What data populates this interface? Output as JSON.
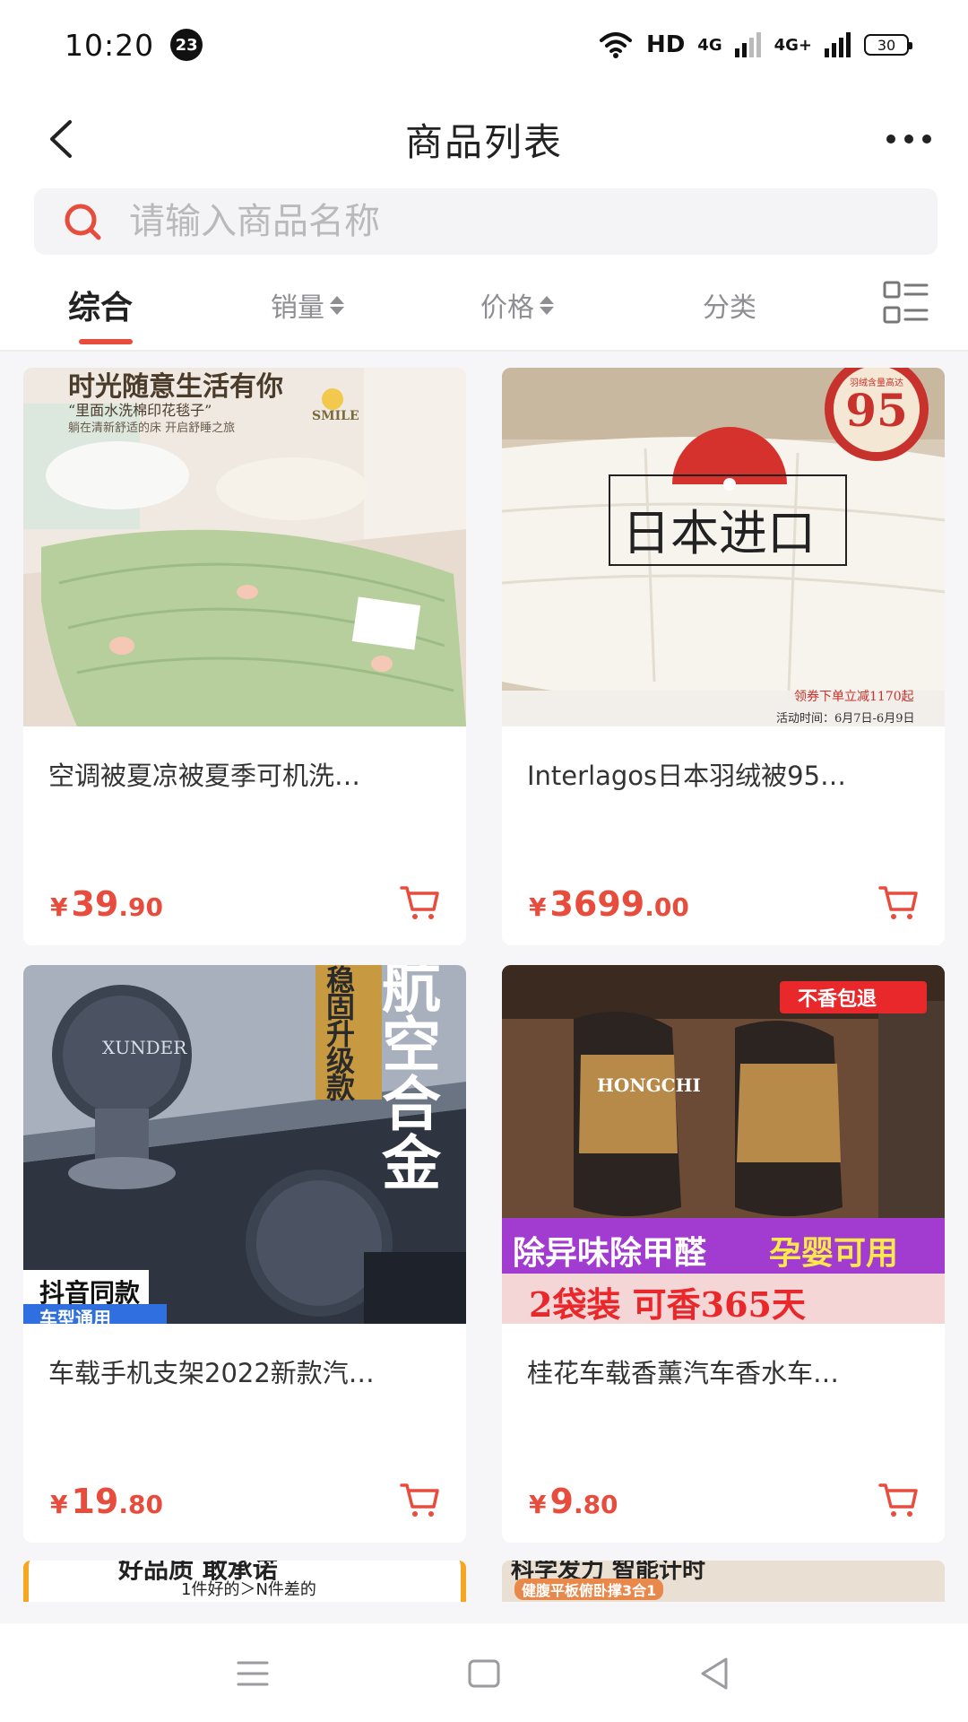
{
  "status_bar": {
    "time": "10:20",
    "notification_count": "23",
    "network_label": "HD",
    "signal_1": "4G",
    "signal_2": "4G+",
    "battery": "30"
  },
  "header": {
    "title": "商品列表",
    "back_icon": "chevron-left-icon",
    "more_icon": "more-dots-icon"
  },
  "search": {
    "placeholder": "请输入商品名称",
    "icon": "search-icon",
    "accent_color": "#e84c3d"
  },
  "tabs": [
    {
      "label": "综合",
      "active": true
    },
    {
      "label": "销量",
      "sortable": true
    },
    {
      "label": "价格",
      "sortable": true
    },
    {
      "label": "分类"
    }
  ],
  "accent_color": "#e84c3d",
  "products": [
    {
      "name": "空调被夏凉被夏季可机洗…",
      "price_symbol": "¥",
      "price_int": "39",
      "price_dec": ".90",
      "image_text_1": "时光随意生活有你",
      "image_text_2": "“里面水洗棉印花毯子”",
      "image_text_3": "躺在清新舒适的床 开启舒睡之旅",
      "image_text_4": "SMILE"
    },
    {
      "name": "Interlagos日本羽绒被95…",
      "price_symbol": "¥",
      "price_int": "3699",
      "price_dec": ".00",
      "image_text_1": "日本进口",
      "image_text_2": "95",
      "image_text_3": "羽绒含量高达",
      "image_text_4": "领券下单立减1170起",
      "image_text_5": "活动时间：6月7日-6月9日"
    },
    {
      "name": "车载手机支架2022新款汽…",
      "price_symbol": "¥",
      "price_int": "19",
      "price_dec": ".80",
      "image_text_1": "航空合金",
      "image_text_2": "稳固升级款",
      "image_text_3": "抖音同款",
      "image_text_4": "车型通用",
      "image_text_5": "XUNDER"
    },
    {
      "name": "桂花车载香薰汽车香水车…",
      "price_symbol": "¥",
      "price_int": "9",
      "price_dec": ".80",
      "image_text_1": "不香包退",
      "image_text_2": "除异味除甲醛",
      "image_text_3": "孕婴可用",
      "image_text_4": "2袋装 可香365天",
      "image_text_5": "HONGCHI"
    }
  ],
  "peek": [
    {
      "text_1": "好品质 敢承诺",
      "text_2": "1件好的＞N件差的"
    },
    {
      "text_1": "科学发力 智能计时",
      "text_2": "健腹平板俯卧撑3合1"
    }
  ],
  "navbar": {
    "menu_icon": "menu-icon",
    "home_icon": "home-square-icon",
    "back_icon": "back-triangle-icon"
  }
}
